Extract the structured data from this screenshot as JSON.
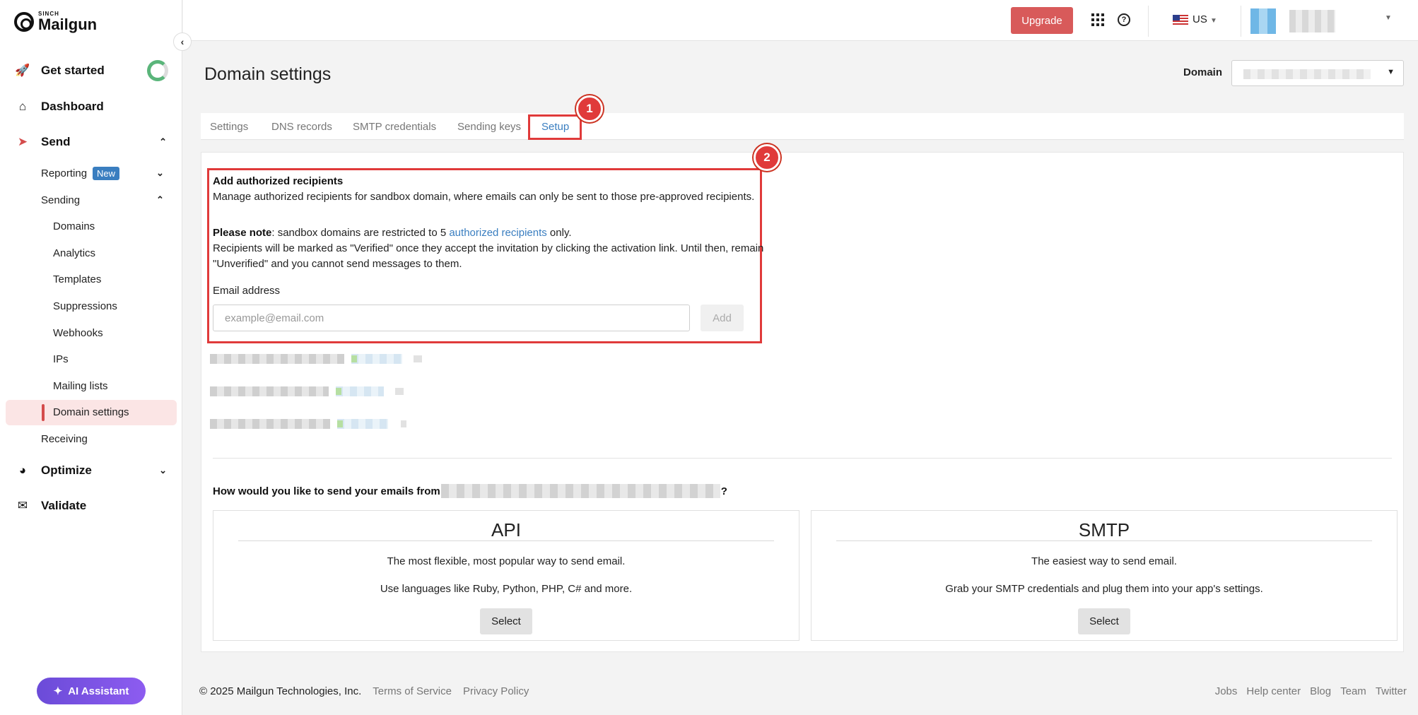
{
  "brand": {
    "sinch": "SINCH",
    "name": "Mailgun"
  },
  "sidebar": {
    "top_items": [
      {
        "label": "Get started"
      },
      {
        "label": "Dashboard"
      },
      {
        "label": "Send"
      }
    ],
    "send_sub": [
      {
        "label": "Reporting",
        "badge": "New"
      },
      {
        "label": "Sending"
      }
    ],
    "sending_items": [
      {
        "label": "Domains"
      },
      {
        "label": "Analytics"
      },
      {
        "label": "Templates"
      },
      {
        "label": "Suppressions"
      },
      {
        "label": "Webhooks"
      },
      {
        "label": "IPs"
      },
      {
        "label": "Mailing lists"
      },
      {
        "label": "Domain settings"
      }
    ],
    "receiving": "Receiving",
    "optimize": "Optimize",
    "validate": "Validate",
    "ai_assistant": "AI Assistant",
    "get_started_progress": 0.7
  },
  "topbar": {
    "upgrade": "Upgrade",
    "region": "US"
  },
  "page": {
    "title": "Domain settings",
    "domain_label": "Domain",
    "tabs": [
      "Settings",
      "DNS records",
      "SMTP credentials",
      "Sending keys",
      "Setup"
    ],
    "active_tab": "Setup"
  },
  "annotations": {
    "marker1": "1",
    "marker2": "2"
  },
  "recipients": {
    "title": "Add authorized recipients",
    "description": "Manage authorized recipients for sandbox domain, where emails can only be sent to those pre-approved recipients.",
    "note_bold": "Please note",
    "note_text": ": sandbox domains are restricted to 5 ",
    "note_link": "authorized recipients",
    "note_end": " only.",
    "verify_line1": "Recipients will be marked as \"Verified\" once they accept the invitation by clicking the activation link. Until then, remain",
    "verify_line2": "\"Unverified\" and you cannot send messages to them.",
    "email_label": "Email address",
    "email_placeholder": "example@email.com",
    "add_button": "Add"
  },
  "send_method": {
    "question_start": "How would you like to send your emails from ",
    "question_end": "?",
    "options": [
      {
        "title": "API",
        "line1": "The most flexible, most popular way to send email.",
        "line2": "Use languages like Ruby, Python, PHP, C# and more.",
        "button": "Select"
      },
      {
        "title": "SMTP",
        "line1": "The easiest way to send email.",
        "line2": "Grab your SMTP credentials and plug them into your app's settings.",
        "button": "Select"
      }
    ]
  },
  "footer": {
    "copyright": "© 2025 Mailgun Technologies, Inc.",
    "terms": "Terms of Service",
    "privacy": "Privacy Policy",
    "links": [
      "Jobs",
      "Help center",
      "Blog",
      "Team",
      "Twitter"
    ]
  },
  "colors": {
    "accent_red": "#d85a5a",
    "link_blue": "#3a7ec0",
    "annotation_red": "#e03a3a"
  }
}
